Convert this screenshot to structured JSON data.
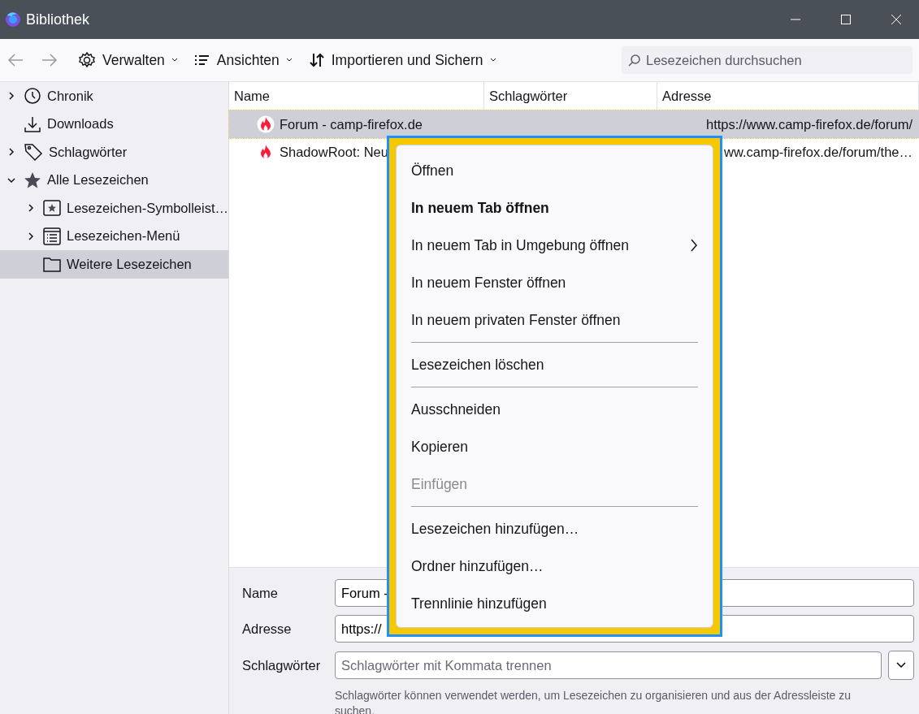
{
  "window": {
    "title": "Bibliothek"
  },
  "toolbar": {
    "buttons": [
      {
        "label": "Verwalten",
        "kind": "gear"
      },
      {
        "label": "Ansichten",
        "kind": "list"
      },
      {
        "label": "Importieren und Sichern",
        "kind": "sort"
      }
    ],
    "search": {
      "placeholder": "Lesezeichen durchsuchen"
    }
  },
  "sidebar": {
    "items": [
      {
        "label": "Chronik",
        "kind": "clock",
        "expanded": false,
        "selected": false
      },
      {
        "label": "Downloads",
        "kind": "download",
        "selected": false
      },
      {
        "label": "Schlagwörter",
        "kind": "tag",
        "expanded": false,
        "selected": false
      },
      {
        "label": "Alle Lesezeichen",
        "kind": "star",
        "expanded": true,
        "selected": false,
        "children": [
          {
            "label": "Lesezeichen-Symbolleist…",
            "kind": "toolbar",
            "expanded": false,
            "selected": false
          },
          {
            "label": "Lesezeichen-Menü",
            "kind": "menu",
            "expanded": false,
            "selected": false
          },
          {
            "label": "Weitere Lesezeichen",
            "kind": "folder",
            "selected": true
          }
        ]
      }
    ]
  },
  "table": {
    "columns": [
      "Name",
      "Schlagwörter",
      "Adresse"
    ],
    "rows": [
      {
        "name": "Forum - camp-firefox.de",
        "address": "https://www.camp-firefox.de/forum/",
        "selected": true
      },
      {
        "name": "ShadowRoot: Neu",
        "address": "ww.camp-firefox.de/forum/the…",
        "selected": false
      }
    ]
  },
  "context_menu": {
    "items": [
      {
        "kind": "item",
        "label": "Öffnen",
        "bold": false,
        "disabled": false,
        "submenu": false
      },
      {
        "kind": "item",
        "label": "In neuem Tab öffnen",
        "bold": true,
        "disabled": false,
        "submenu": false
      },
      {
        "kind": "item",
        "label": "In neuem Tab in Umgebung öffnen",
        "bold": false,
        "disabled": false,
        "submenu": true
      },
      {
        "kind": "item",
        "label": "In neuem Fenster öffnen",
        "bold": false,
        "disabled": false,
        "submenu": false
      },
      {
        "kind": "item",
        "label": "In neuem privaten Fenster öffnen",
        "bold": false,
        "disabled": false,
        "submenu": false
      },
      {
        "kind": "separator"
      },
      {
        "kind": "item",
        "label": "Lesezeichen löschen",
        "bold": false,
        "disabled": false,
        "submenu": false
      },
      {
        "kind": "separator"
      },
      {
        "kind": "item",
        "label": "Ausschneiden",
        "bold": false,
        "disabled": false,
        "submenu": false
      },
      {
        "kind": "item",
        "label": "Kopieren",
        "bold": false,
        "disabled": false,
        "submenu": false
      },
      {
        "kind": "item",
        "label": "Einfügen",
        "bold": false,
        "disabled": true,
        "submenu": false
      },
      {
        "kind": "separator"
      },
      {
        "kind": "item",
        "label": "Lesezeichen hinzufügen…",
        "bold": false,
        "disabled": false,
        "submenu": false
      },
      {
        "kind": "item",
        "label": "Ordner hinzufügen…",
        "bold": false,
        "disabled": false,
        "submenu": false
      },
      {
        "kind": "item",
        "label": "Trennlinie hinzufügen",
        "bold": false,
        "disabled": false,
        "submenu": false
      }
    ]
  },
  "details": {
    "fields": [
      {
        "label": "Name",
        "value": "Forum -",
        "kind": "text"
      },
      {
        "label": "Adresse",
        "value": "https://",
        "kind": "text"
      },
      {
        "label": "Schlagwörter",
        "placeholder": "Schlagwörter mit Kommata trennen",
        "kind": "tags"
      }
    ],
    "hint": "Schlagwörter können verwendet werden, um Lesezeichen zu organisieren und aus der Adressleiste zu suchen."
  }
}
